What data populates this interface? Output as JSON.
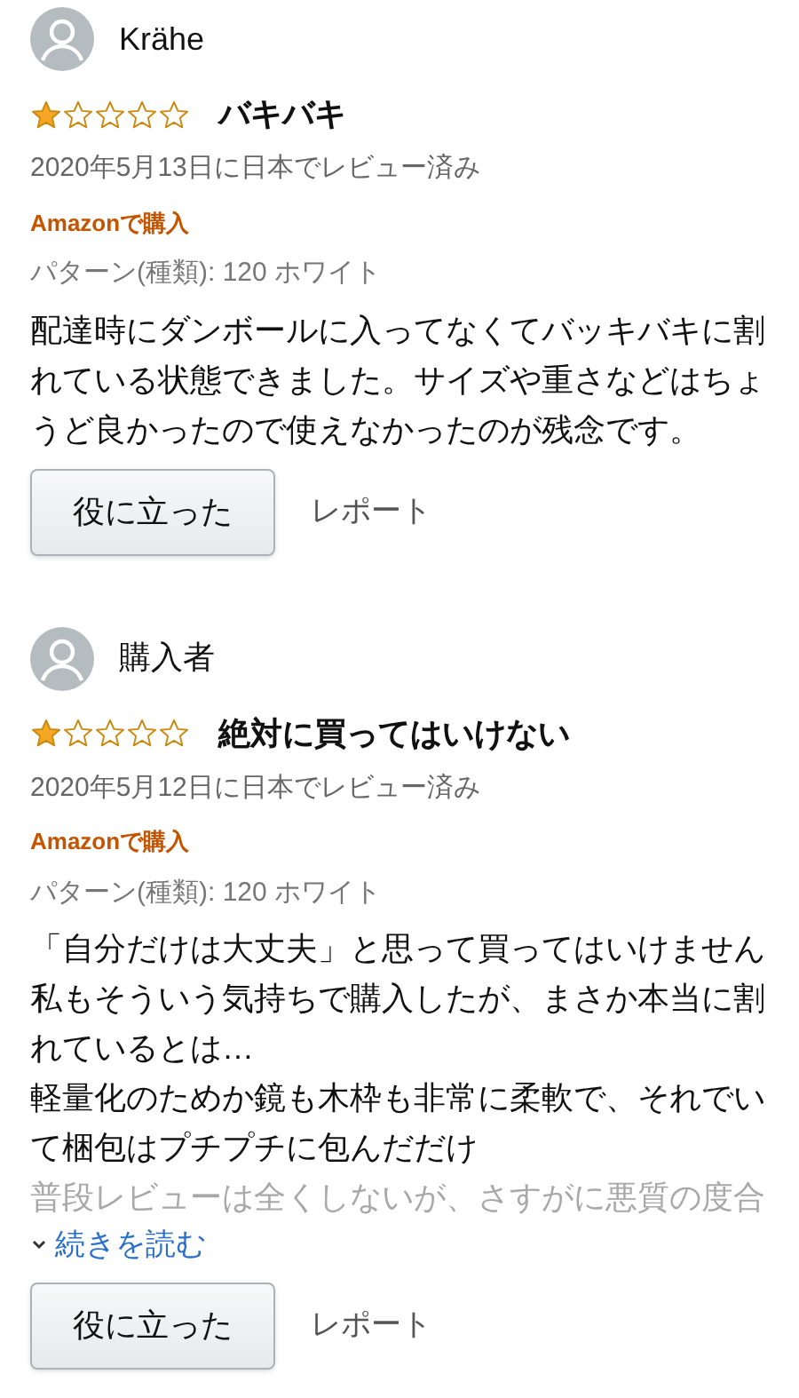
{
  "reviews": [
    {
      "author": "Krähe",
      "stars": 1,
      "title": "バキバキ",
      "date": "2020年5月13日に日本でレビュー済み",
      "badge": "Amazonで購入",
      "variant": "パターン(種類): 120 ホワイト",
      "body_lines": [
        "配達時にダンボールに入ってなくてバッキバキに割",
        "れている状態できました。サイズや重さなどはちょ",
        "うど良かったので使えなかったのが残念です。"
      ],
      "helpful": "役に立った",
      "report": "レポート"
    },
    {
      "author": "購入者",
      "stars": 1,
      "title": "絶対に買ってはいけない",
      "date": "2020年5月12日に日本でレビュー済み",
      "badge": "Amazonで購入",
      "variant": "パターン(種類): 120 ホワイト",
      "body_lines": [
        "「自分だけは大丈夫」と思って買ってはいけません",
        "私もそういう気持ちで購入したが、まさか本当に割",
        "れているとは…",
        "軽量化のためか鏡も木枠も非常に柔軟で、それでい",
        "て梱包はプチプチに包んだだけ",
        "普段レビューは全くしないが、さすがに悪質の度合"
      ],
      "truncated": true,
      "read_more": "続きを読む",
      "helpful": "役に立った",
      "report": "レポート"
    }
  ]
}
